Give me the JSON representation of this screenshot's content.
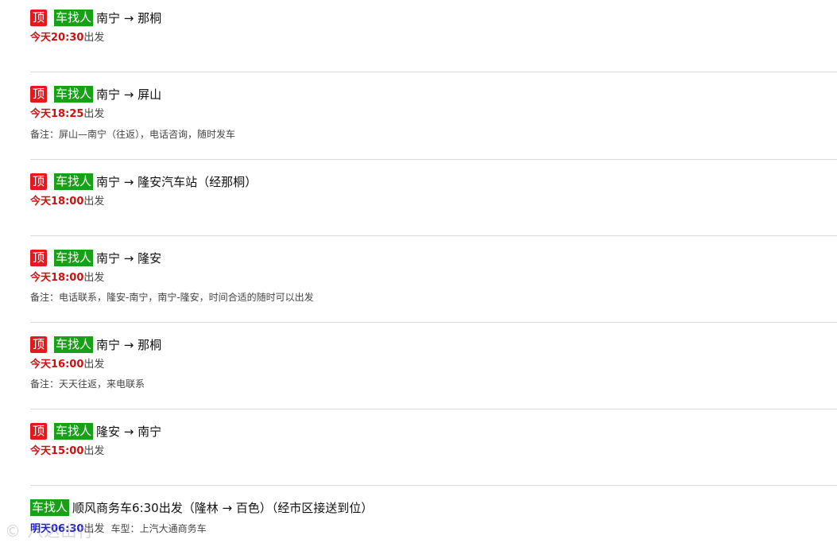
{
  "tags": {
    "top": "顶",
    "type": "车找人",
    "depart_suffix": "出发",
    "note_prefix": "备注：",
    "car_prefix": "车型："
  },
  "listings": [
    {
      "route": "南宁 → 那桐",
      "time": "今天20:30",
      "note": ""
    },
    {
      "route": "南宁 → 屏山",
      "time": "今天18:25",
      "note": "屏山—南宁（往返），电话咨询，随时发车"
    },
    {
      "route": "南宁 → 隆安汽车站（经那桐）",
      "time": "今天18:00",
      "note": ""
    },
    {
      "route": "南宁 → 隆安",
      "time": "今天18:00",
      "note": "电话联系，隆安-南宁，南宁-隆安，时间合适的随时可以出发"
    },
    {
      "route": "南宁 → 那桐",
      "time": "今天16:00",
      "note": "天天往返，来电联系"
    },
    {
      "route": "隆安 → 南宁",
      "time": "今天15:00",
      "note": ""
    }
  ],
  "last_listing": {
    "title": "顺风商务车6:30出发（隆林 → 百色）（经市区接送到位）",
    "time": "明天06:30",
    "car": "上汽大通商务车"
  },
  "watermark": "© 八达出行"
}
